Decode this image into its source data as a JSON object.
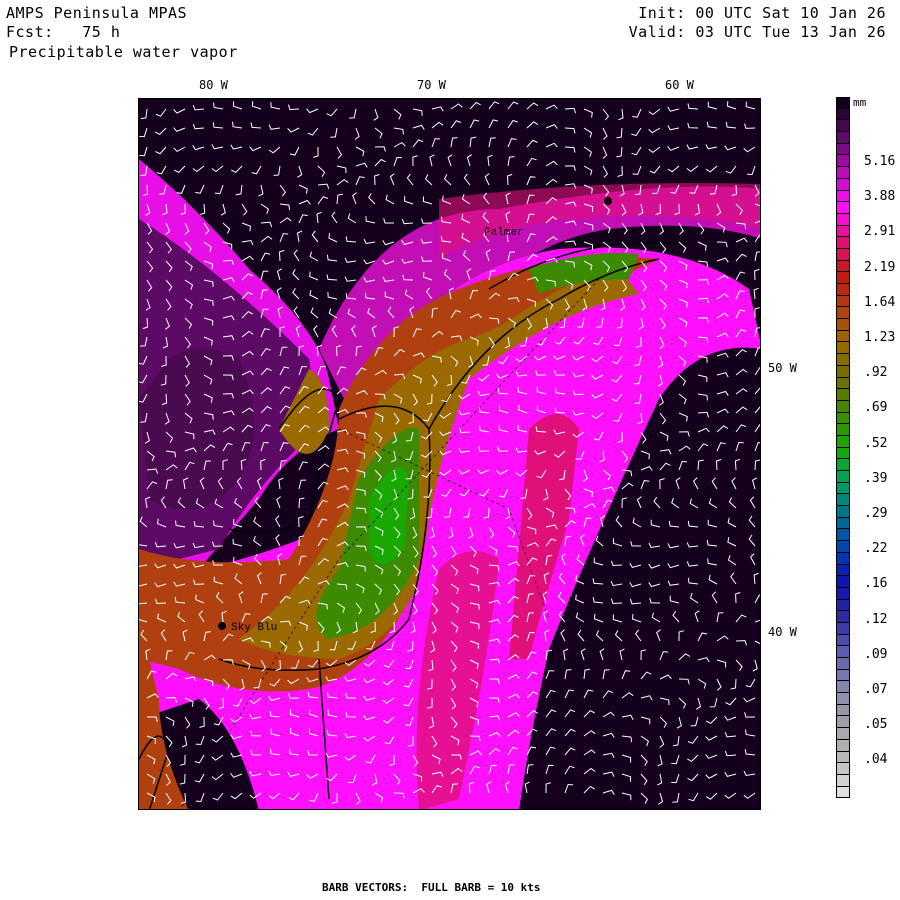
{
  "header": {
    "model": "AMPS Peninsula MPAS",
    "forecast": "Fcst:   75 h",
    "field": "Precipitable water vapor",
    "init": "Init: 00 UTC Sat 10 Jan 26",
    "valid": "Valid: 03 UTC Tue 13 Jan 26"
  },
  "axes": {
    "top_labels": [
      "80 W",
      "70 W",
      "60 W"
    ],
    "right_labels": [
      "50 W",
      "40 W"
    ]
  },
  "stations": [
    "Palmer",
    "Sky Blu"
  ],
  "colorbar": {
    "unit": "mm",
    "labels": [
      "5.16",
      "3.88",
      "2.91",
      "2.19",
      "1.64",
      "1.23",
      ".92",
      ".69",
      ".52",
      ".39",
      ".29",
      ".22",
      ".16",
      ".12",
      ".09",
      ".07",
      ".05",
      ".04"
    ],
    "key_colors": [
      "#12001a",
      "#5c0a66",
      "#b80cb8",
      "#ff10ff",
      "#e0107a",
      "#c01a10",
      "#b04010",
      "#9a6a00",
      "#707000",
      "#3c8a00",
      "#18a800",
      "#00a060",
      "#007090",
      "#0040b0",
      "#1010b0",
      "#3030a0",
      "#6060b0",
      "#8888b0",
      "#a0a0a8",
      "#b8b8b8",
      "#e0e0e0"
    ]
  },
  "footer": "BARB VECTORS:  FULL BARB = 10 kts"
}
